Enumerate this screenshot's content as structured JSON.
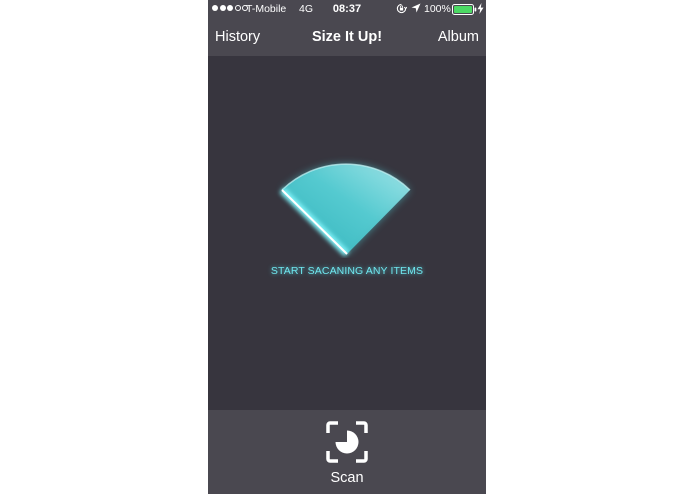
{
  "status_bar": {
    "carrier": "T-Mobile",
    "network": "4G",
    "time": "08:37",
    "battery": "100%"
  },
  "nav": {
    "left_label": "History",
    "title": "Size It Up!",
    "right_label": "Album"
  },
  "main": {
    "prompt": "START SACANING ANY ITEMS"
  },
  "toolbar": {
    "scan_label": "Scan"
  },
  "colors": {
    "nav_background": "#4a4850",
    "content_background": "#37353e",
    "accent": "#6fe6ee",
    "battery": "#4cd964"
  },
  "icons": {
    "scan": "scan-frame-icon",
    "location": "location-arrow-icon",
    "orientation": "orientation-lock-icon",
    "battery": "battery-icon",
    "charge": "charging-bolt-icon"
  }
}
